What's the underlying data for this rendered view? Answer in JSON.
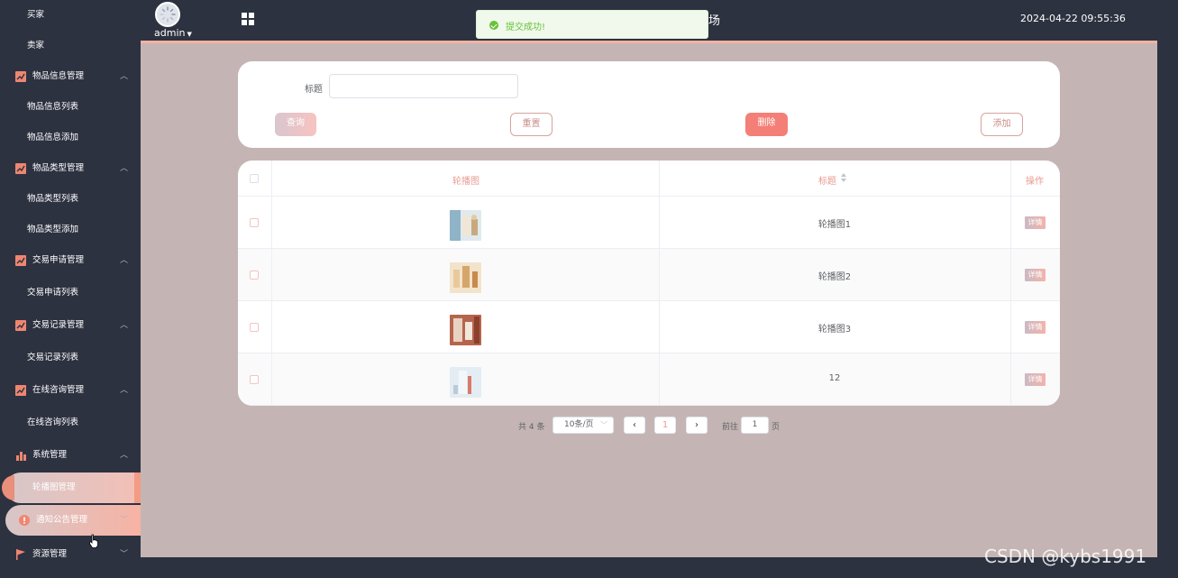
{
  "sidebar": {
    "items": [
      {
        "label": "买家",
        "type": "sub"
      },
      {
        "label": "卖家",
        "type": "sub"
      },
      {
        "label": "物品信息管理",
        "type": "group",
        "icon": "line-chart-icon"
      },
      {
        "label": "物品信息列表",
        "type": "sub"
      },
      {
        "label": "物品信息添加",
        "type": "sub"
      },
      {
        "label": "物品类型管理",
        "type": "group",
        "icon": "line-chart-icon"
      },
      {
        "label": "物品类型列表",
        "type": "sub"
      },
      {
        "label": "物品类型添加",
        "type": "sub"
      },
      {
        "label": "交易申请管理",
        "type": "group",
        "icon": "line-chart-icon"
      },
      {
        "label": "交易申请列表",
        "type": "sub"
      },
      {
        "label": "交易记录管理",
        "type": "group",
        "icon": "line-chart-icon"
      },
      {
        "label": "交易记录列表",
        "type": "sub"
      },
      {
        "label": "在线咨询管理",
        "type": "group",
        "icon": "line-chart-icon"
      },
      {
        "label": "在线咨询列表",
        "type": "sub"
      },
      {
        "label": "系统管理",
        "type": "group",
        "icon": "bar-chart-icon"
      },
      {
        "label": "轮播图管理",
        "type": "sub",
        "active": true
      },
      {
        "label": "通知公告管理",
        "type": "sub-hover",
        "icon": "info-icon"
      },
      {
        "label": "资源管理",
        "type": "group",
        "icon": "flag-icon"
      }
    ]
  },
  "header": {
    "user": "admin",
    "title_fragment": "场",
    "datetime": "2024-04-22 09:55:36"
  },
  "toast": {
    "message": "提交成功!",
    "color": "#67c23a"
  },
  "search": {
    "title_label": "标题",
    "title_value": "",
    "query_label": "查询",
    "reset_label": "重置",
    "delete_label": "删除",
    "add_label": "添加"
  },
  "table": {
    "columns": [
      "轮播图",
      "标题",
      "操作"
    ],
    "rows": [
      {
        "title": "轮播图1",
        "action": "详情"
      },
      {
        "title": "轮播图2",
        "action": "详情"
      },
      {
        "title": "轮播图3",
        "action": "详情"
      },
      {
        "title": "12",
        "action": "详情"
      }
    ]
  },
  "pagination": {
    "total": "共 4 条",
    "page_size": "10条/页",
    "current_page": "1",
    "goto_label": "前往",
    "goto_value": "1",
    "page_suffix": "页"
  },
  "watermark": "CSDN @kybs1991",
  "colors": {
    "sidebar_bg": "#2d3240",
    "main_bg": "#c4b5b4",
    "accent": "#f3b1a2",
    "delete": "#f47f76"
  }
}
